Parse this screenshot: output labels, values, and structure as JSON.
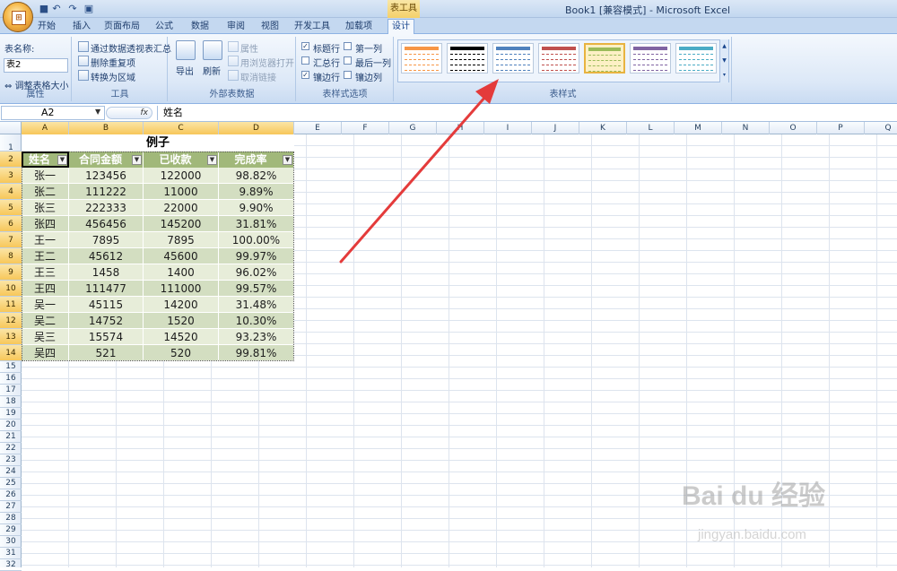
{
  "window": {
    "title": "Book1  [兼容模式] - Microsoft Excel",
    "context_tab": "表工具"
  },
  "tabs": [
    {
      "label": "开始"
    },
    {
      "label": "插入"
    },
    {
      "label": "页面布局"
    },
    {
      "label": "公式"
    },
    {
      "label": "数据"
    },
    {
      "label": "审阅"
    },
    {
      "label": "视图"
    },
    {
      "label": "开发工具"
    },
    {
      "label": "加载项"
    },
    {
      "label": "设计",
      "active": true
    }
  ],
  "ribbon": {
    "properties": {
      "label": "属性",
      "name_label": "表名称:",
      "name_value": "表2",
      "resize": "调整表格大小"
    },
    "tools": {
      "label": "工具",
      "pivot": "通过数据透视表汇总",
      "remove_dup": "删除重复项",
      "convert": "转换为区域"
    },
    "external": {
      "label": "外部表数据",
      "export": "导出",
      "refresh": "刷新",
      "props": "属性",
      "open_browser": "用浏览器打开",
      "unlink": "取消链接"
    },
    "style_options": {
      "label": "表样式选项",
      "header_row": "标题行",
      "total_row": "汇总行",
      "banded_rows": "镶边行",
      "first_col": "第一列",
      "last_col": "最后一列",
      "banded_cols": "镶边列",
      "header_row_checked": true,
      "total_row_checked": false,
      "banded_rows_checked": true,
      "first_col_checked": false,
      "last_col_checked": false,
      "banded_cols_checked": false
    },
    "styles": {
      "label": "表样式",
      "swatch_colors": [
        "#f79646",
        "#000000",
        "#4f81bd",
        "#c0504d",
        "#9bbb59",
        "#8064a2",
        "#4bacc6"
      ],
      "selected_index": 4
    }
  },
  "formula_bar": {
    "cell_ref": "A2",
    "fx": "fx",
    "value": "姓名"
  },
  "columns": [
    "A",
    "B",
    "C",
    "D",
    "E",
    "F",
    "G",
    "H",
    "I",
    "J",
    "K",
    "L",
    "M",
    "N",
    "O",
    "P",
    "Q"
  ],
  "rows": [
    "1",
    "2",
    "3",
    "4",
    "5",
    "6",
    "7",
    "8",
    "9",
    "10",
    "11",
    "12",
    "13",
    "14",
    "15",
    "16",
    "17",
    "18",
    "19",
    "20",
    "21",
    "22",
    "23",
    "24",
    "25",
    "26",
    "27",
    "28",
    "29",
    "30",
    "31",
    "32"
  ],
  "sheet": {
    "title": "例子",
    "headers": [
      "姓名",
      "合同金额",
      "已收款",
      "完成率"
    ],
    "data": [
      [
        "张一",
        "123456",
        "122000",
        "98.82%"
      ],
      [
        "张二",
        "111222",
        "11000",
        "9.89%"
      ],
      [
        "张三",
        "222333",
        "22000",
        "9.90%"
      ],
      [
        "张四",
        "456456",
        "145200",
        "31.81%"
      ],
      [
        "王一",
        "7895",
        "7895",
        "100.00%"
      ],
      [
        "王二",
        "45612",
        "45600",
        "99.97%"
      ],
      [
        "王三",
        "1458",
        "1400",
        "96.02%"
      ],
      [
        "王四",
        "111477",
        "111000",
        "99.57%"
      ],
      [
        "吴一",
        "45115",
        "14200",
        "31.48%"
      ],
      [
        "吴二",
        "14752",
        "1520",
        "10.30%"
      ],
      [
        "吴三",
        "15574",
        "14520",
        "93.23%"
      ],
      [
        "吴四",
        "521",
        "520",
        "99.81%"
      ]
    ]
  },
  "watermark": {
    "brand": "Bai du 经验",
    "url": "jingyan.baidu.com"
  },
  "colors": {
    "header_green": "#a1b87a",
    "band_light": "#e7edd9",
    "band_dark": "#d3dec1",
    "arrow_red": "#e43b3b"
  }
}
